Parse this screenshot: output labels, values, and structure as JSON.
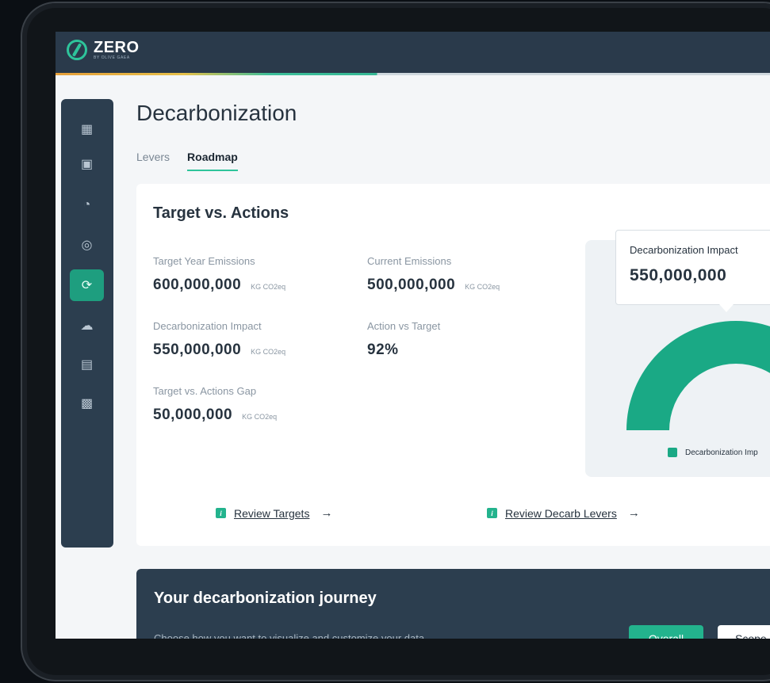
{
  "app": {
    "logo_text": "ZERO",
    "logo_sub": "BY OLIVE GAEA"
  },
  "sidebar": {
    "items": [
      {
        "icon": "dashboard-icon",
        "glyph": "▦"
      },
      {
        "icon": "inbox-icon",
        "glyph": "▣"
      },
      {
        "icon": "search-analytics-icon",
        "glyph": "◔"
      },
      {
        "icon": "target-icon",
        "glyph": "◎"
      },
      {
        "icon": "decarbonization-icon",
        "glyph": "⟳"
      },
      {
        "icon": "co2-icon",
        "glyph": "☁"
      },
      {
        "icon": "report-icon",
        "glyph": "▤"
      },
      {
        "icon": "grid-icon",
        "glyph": "▩"
      }
    ],
    "active_index": 4
  },
  "page": {
    "title": "Decarbonization"
  },
  "tabs": [
    {
      "label": "Levers"
    },
    {
      "label": "Roadmap"
    }
  ],
  "card": {
    "title": "Target vs. Actions",
    "metrics": [
      {
        "label": "Target Year Emissions",
        "value": "600,000,000",
        "unit": "KG CO2eq"
      },
      {
        "label": "Current Emissions",
        "value": "500,000,000",
        "unit": "KG CO2eq"
      },
      {
        "label": "Decarbonization Impact",
        "value": "550,000,000",
        "unit": "KG CO2eq"
      },
      {
        "label": "Action vs Target",
        "value": "92%",
        "unit": ""
      },
      {
        "label": "Target vs. Actions Gap",
        "value": "50,000,000",
        "unit": "KG CO2eq"
      }
    ],
    "links": {
      "review_targets": "Review Targets",
      "review_levers": "Review Decarb Levers",
      "info_glyph": "i",
      "arrow": "→"
    }
  },
  "chart": {
    "tooltip_label": "Decarbonization Impact",
    "tooltip_value": "550,000,000",
    "legend_label": "Decarbonization Imp",
    "gauge_color": "#1aa985",
    "gauge_value": 550000000
  },
  "journey": {
    "title": "Your decarbonization journey",
    "subtitle": "Choose how you want to visualize and customize your data",
    "btn_overall": "Overall",
    "btn_scope": "Scope"
  }
}
